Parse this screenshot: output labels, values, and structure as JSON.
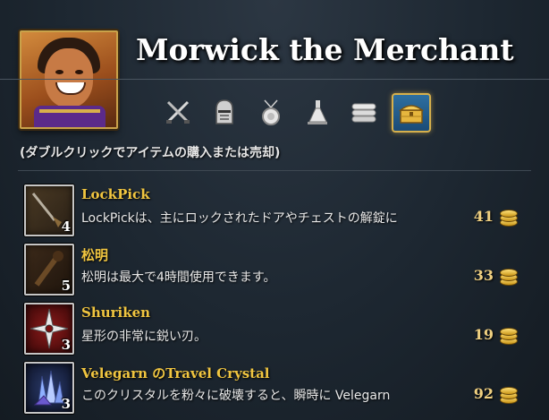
{
  "merchant": {
    "name": "Morwick the Merchant"
  },
  "tabs": [
    {
      "icon": "crossed-swords-icon",
      "active": false
    },
    {
      "icon": "knight-helmet-icon",
      "active": false
    },
    {
      "icon": "amulet-icon",
      "active": false
    },
    {
      "icon": "potion-flask-icon",
      "active": false
    },
    {
      "icon": "scroll-bundle-icon",
      "active": false
    },
    {
      "icon": "treasure-chest-icon",
      "active": true
    }
  ],
  "hint": "(ダブルクリックでアイテムの購入または売却)",
  "items": [
    {
      "name": "LockPick",
      "desc": "LockPickは、主にロックされたドアやチェストの解錠に",
      "qty": "4",
      "price": "41",
      "icon": "lockpick-icon"
    },
    {
      "name": "松明",
      "desc": "松明は最大で4時間使用できます。",
      "qty": "5",
      "price": "33",
      "icon": "torch-icon"
    },
    {
      "name": "Shuriken",
      "desc": "星形の非常に鋭い刃。",
      "qty": "3",
      "price": "19",
      "icon": "shuriken-icon"
    },
    {
      "name": "Velegarn のTravel Crystal",
      "desc": "このクリスタルを粉々に破壊すると、瞬時に Velegarn",
      "qty": "3",
      "price": "92",
      "icon": "crystal-icon"
    }
  ],
  "colors": {
    "item_name": "#f0c540",
    "tab_active": "#2d6fa1",
    "gold_border": "#d6b04c"
  }
}
